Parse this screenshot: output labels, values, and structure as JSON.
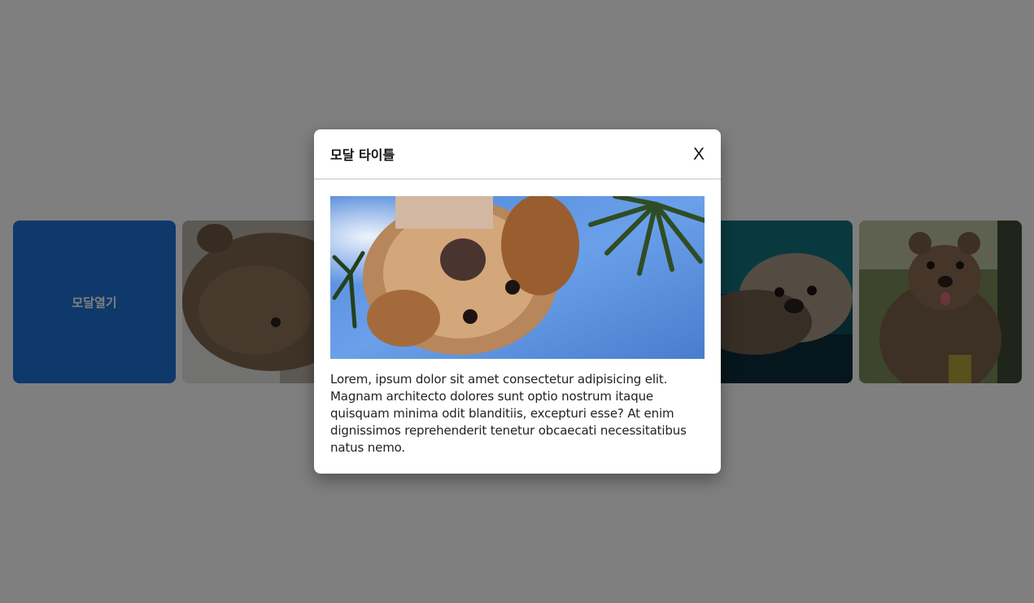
{
  "gallery": {
    "open_label": "모달열기",
    "photos": [
      "quokka-side-photo",
      "otter-photo",
      "quokka-smile-photo"
    ]
  },
  "modal": {
    "title": "모달 타이틀",
    "close_label": "X",
    "image": "upside-down-dog-photo",
    "body": "Lorem, ipsum dolor sit amet consectetur adipisicing elit. Magnam architecto dolores sunt optio nostrum itaque quisquam minima odit blanditiis, excepturi esse? At enim dignissimos reprehenderit tenetur obcaecati necessitatibus natus nemo."
  },
  "colors": {
    "accent": "#1e73d6",
    "overlay": "rgba(0,0,0,0.5)"
  }
}
